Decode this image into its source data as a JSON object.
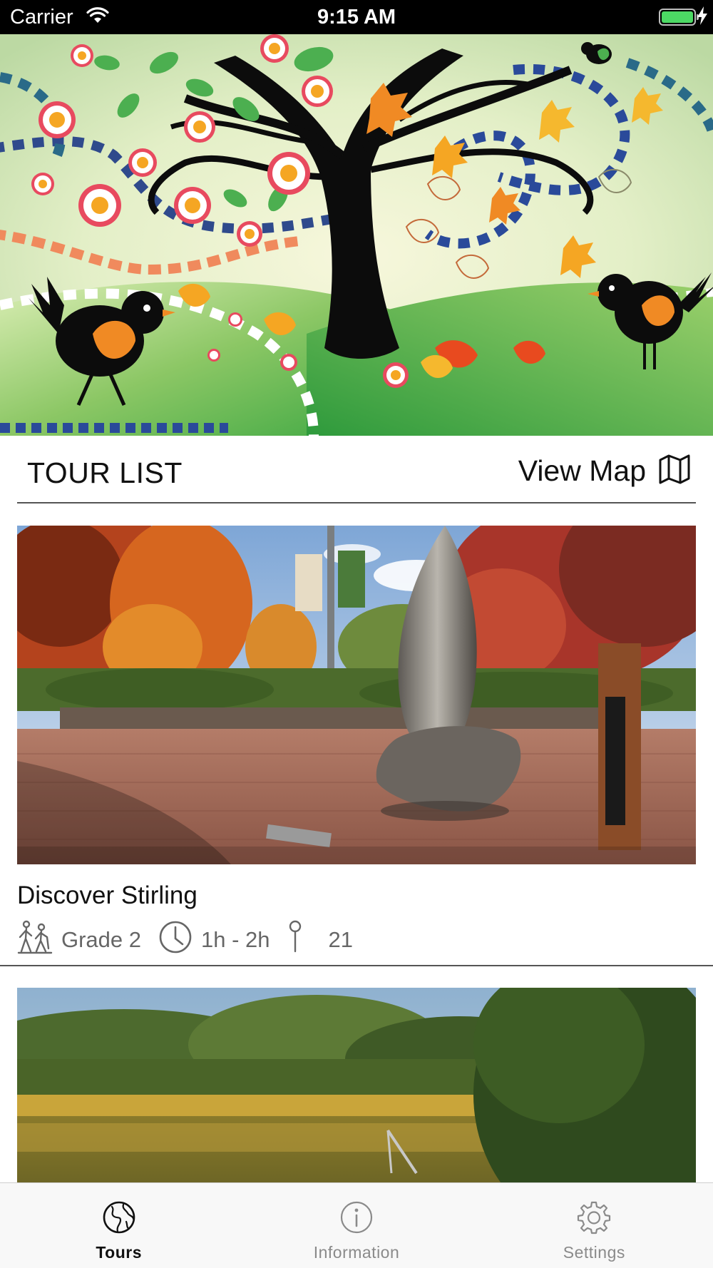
{
  "status_bar": {
    "carrier": "Carrier",
    "time": "9:15 AM",
    "battery_level": 1.0,
    "battery_color": "#4cd964"
  },
  "header": {
    "title": "TOUR LIST",
    "view_map_label": "View Map",
    "view_map_icon": "map-icon"
  },
  "tours": [
    {
      "name": "Discover Stirling",
      "grade": "Grade 2",
      "duration": "1h - 2h",
      "stops": "21",
      "grade_icon": "hikers-icon",
      "duration_icon": "clock-icon",
      "stops_icon": "pin-icon"
    },
    {
      "name": "",
      "grade": "",
      "duration": "",
      "stops": ""
    }
  ],
  "tab_bar": {
    "active_color": "#111111",
    "inactive_color": "#8a8a8a",
    "items": [
      {
        "label": "Tours",
        "icon": "globe-icon",
        "active": true
      },
      {
        "label": "Information",
        "icon": "info-icon",
        "active": false
      },
      {
        "label": "Settings",
        "icon": "gear-icon",
        "active": false
      }
    ]
  }
}
